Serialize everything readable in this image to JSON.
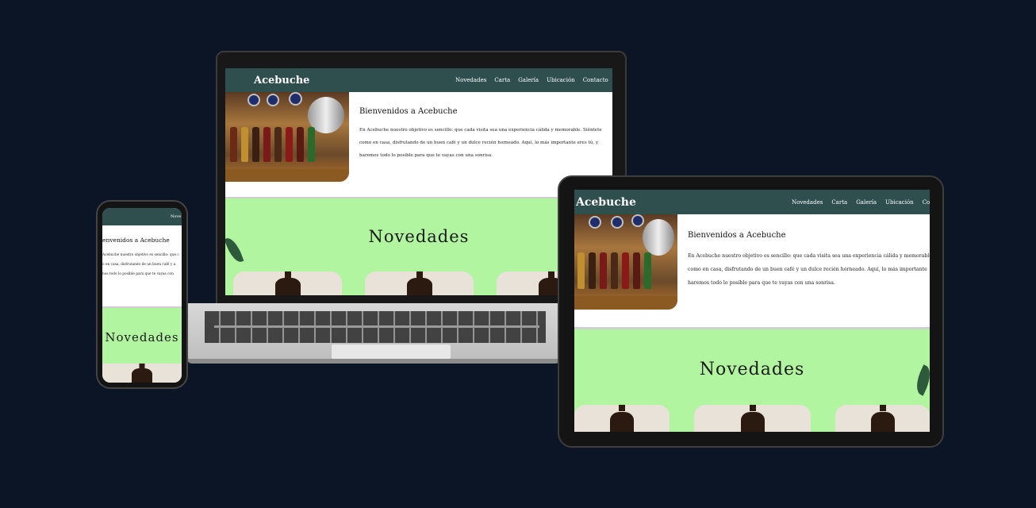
{
  "site": {
    "brand": "Acebuche",
    "nav": [
      "Novedades",
      "Carta",
      "Galería",
      "Ubicación",
      "Contacto"
    ],
    "phone_nav_partial": "Nove",
    "hero_title": "Bienvenidos a Acebuche",
    "laptop_hero_lines": [
      "En Acebuche nuestro objetivo es sencillo: que cada visita sea una experiencia cálida y memorable. Siéntete",
      "como en casa, disfrutando de un buen café y un dulce recién horneado. Aquí, lo más importante eres tú, y",
      "haremos todo lo posible para que te vayas con una sonrisa."
    ],
    "tablet_hero_lines": [
      "En Acebuche nuestro objetivo es sencillo: que cada visita sea una experiencia cálida y memorable",
      "como en casa, disfrutando de un buen café y un dulce recién horneado. Aquí, lo más importante",
      "haremos todo lo posible para que te vayas con una sonrisa."
    ],
    "phone_hero_title": "envenidos a Acebuche",
    "phone_hero_lines": [
      "Acebuche nuestro objetivo es sencillo: que c",
      "o en casa, disfrutando de un buen café y u",
      "nos todo lo posible para que te vayas con"
    ],
    "news_title": "Novedades"
  },
  "colors": {
    "background": "#0c1526",
    "nav": "#2f4f4f",
    "news_bg": "#b2f5a0"
  }
}
